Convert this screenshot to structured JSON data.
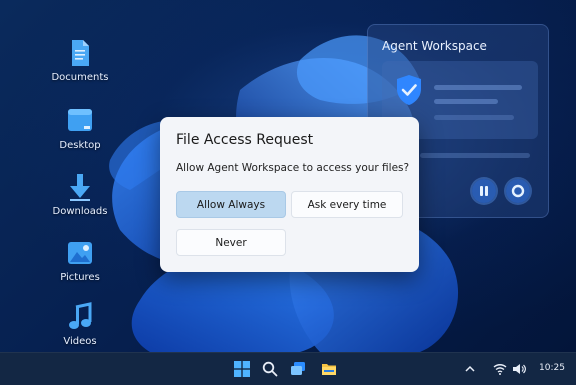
{
  "desktop": {
    "icons": [
      {
        "label": "Documents",
        "icon": "document-icon"
      },
      {
        "label": "Desktop",
        "icon": "desktop-icon"
      },
      {
        "label": "Downloads",
        "icon": "download-arrow-icon"
      },
      {
        "label": "Pictures",
        "icon": "picture-icon"
      },
      {
        "label": "Videos",
        "icon": "music-note-icon"
      }
    ]
  },
  "agent_panel": {
    "title": "Agent Workspace",
    "status_icon": "shield-check-icon",
    "controls": [
      "pause-icon",
      "stop-icon"
    ]
  },
  "dialog": {
    "title": "File Access Request",
    "message": "Allow Agent Workspace to access your files?",
    "buttons": {
      "allow_always": "Allow Always",
      "ask_every_time": "Ask every time",
      "never": "Never"
    }
  },
  "taskbar": {
    "icons": [
      "start-icon",
      "search-icon",
      "task-view-icon",
      "file-explorer-icon"
    ],
    "tray": [
      "chevron-up-icon",
      "wifi-icon",
      "volume-icon"
    ],
    "time": "10:25"
  },
  "colors": {
    "accent": "#1f6fe5",
    "dialog_bg": "#f3f5f9",
    "primary_button": "#bcd8f0",
    "taskbar_bg": "#132744"
  }
}
